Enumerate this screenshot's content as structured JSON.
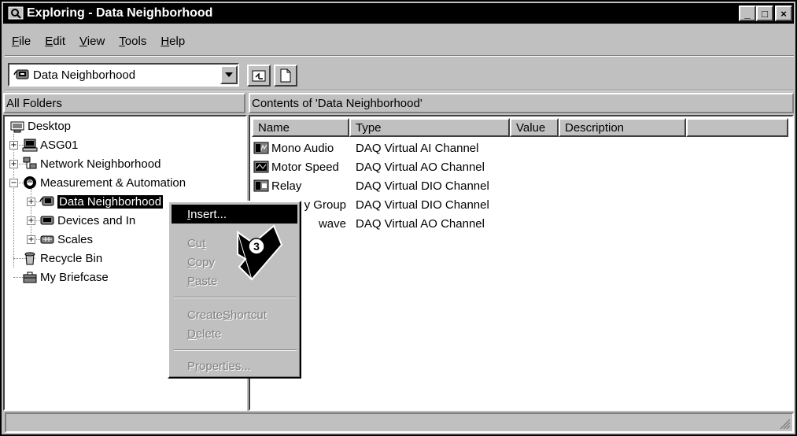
{
  "window": {
    "title": "Exploring - Data Neighborhood",
    "minimize": "_",
    "maximize": "□",
    "close": "×"
  },
  "menu": {
    "items": [
      {
        "label": "File",
        "key": "F",
        "rest": "ile"
      },
      {
        "label": "Edit",
        "key": "E",
        "rest": "dit"
      },
      {
        "label": "View",
        "key": "V",
        "rest": "iew"
      },
      {
        "label": "Tools",
        "key": "T",
        "rest": "ools"
      },
      {
        "label": "Help",
        "key": "H",
        "rest": "elp"
      }
    ]
  },
  "toolbar": {
    "location_value": "Data Neighborhood"
  },
  "left_pane": {
    "header": "All Folders",
    "tree": [
      {
        "label": "Desktop",
        "icon": "desktop-icon"
      },
      {
        "label": "ASG01",
        "icon": "computer-icon"
      },
      {
        "label": "Network Neighborhood",
        "icon": "network-neighborhood-icon"
      },
      {
        "label": "Measurement & Automation",
        "icon": "measurement-automation-icon"
      },
      {
        "label": "Data Neighborhood",
        "icon": "data-neighborhood-icon"
      },
      {
        "label": "Devices and In",
        "icon": "devices-interfaces-icon"
      },
      {
        "label": "Scales",
        "icon": "scales-icon"
      },
      {
        "label": "Recycle Bin",
        "icon": "recycle-bin-icon"
      },
      {
        "label": "My Briefcase",
        "icon": "briefcase-icon"
      }
    ]
  },
  "right_pane": {
    "header": "Contents of 'Data Neighborhood'",
    "columns": [
      "Name",
      "Type",
      "Value",
      "Description"
    ],
    "rows": [
      {
        "name": "Mono Audio",
        "type": "DAQ Virtual AI Channel",
        "icon": "ai-channel-icon"
      },
      {
        "name": "Motor Speed",
        "type": "DAQ Virtual AO Channel",
        "icon": "ao-channel-icon"
      },
      {
        "name": "Relay",
        "type": "DAQ Virtual DIO Channel",
        "icon": "dio-channel-icon"
      },
      {
        "name": "y Group",
        "type": "DAQ Virtual DIO Channel",
        "icon": "dio-channel-icon"
      },
      {
        "name": "wave",
        "type": "DAQ Virtual AO Channel",
        "icon": "ao-channel-icon"
      }
    ]
  },
  "context_menu": {
    "items": [
      {
        "label": "Insert...",
        "key": "I",
        "rest": "nsert...",
        "pre": ""
      },
      {
        "label": "Cut",
        "key": "t",
        "pre": "Cu",
        "rest": ""
      },
      {
        "label": "Copy",
        "key": "C",
        "pre": "",
        "rest": "opy"
      },
      {
        "label": "Paste",
        "key": "P",
        "pre": "",
        "rest": "aste"
      },
      {
        "label": "Create Shortcut",
        "key": "S",
        "pre": "Create ",
        "rest": "hortcut"
      },
      {
        "label": "Delete",
        "key": "D",
        "pre": "",
        "rest": "elete"
      },
      {
        "label": "Properties...",
        "key": "r",
        "pre": "P",
        "rest": "operties..."
      }
    ]
  },
  "callout": {
    "number": "3"
  }
}
